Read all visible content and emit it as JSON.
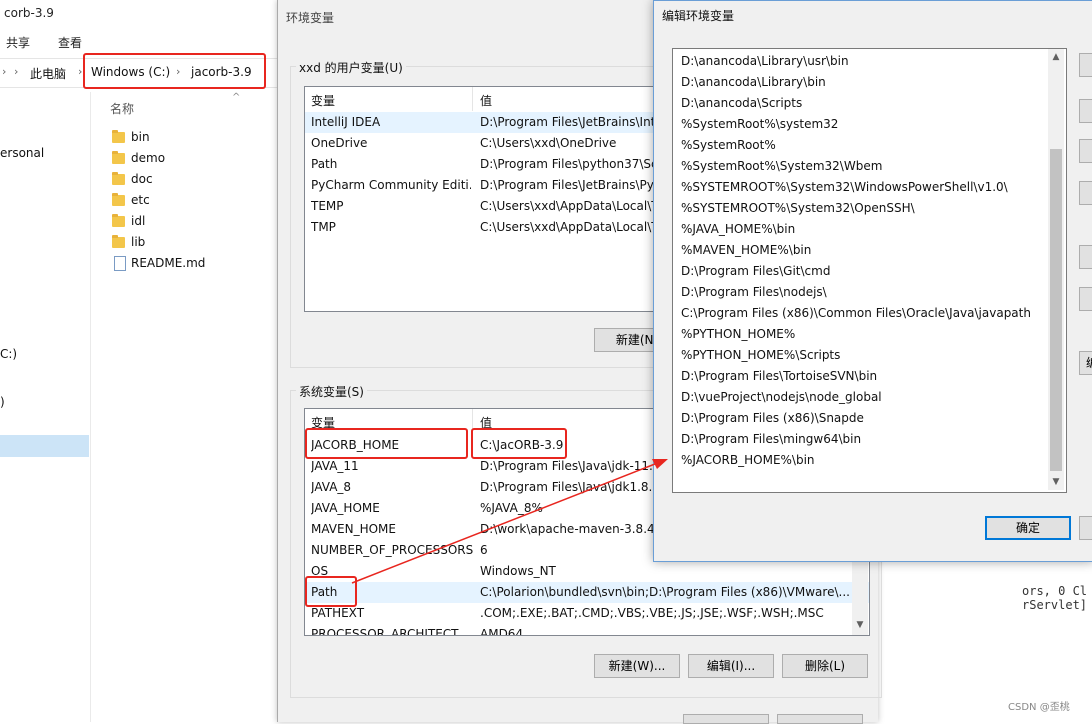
{
  "explorer": {
    "title": "corb-3.9",
    "ribbon_tabs": [
      "共享",
      "查看"
    ],
    "breadcrumbs": [
      "此电脑",
      "Windows (C:)",
      "jacorb-3.9"
    ],
    "nav_items": [
      "ersonal",
      "C:)",
      ")"
    ],
    "column_name": "名称",
    "files": [
      {
        "name": "bin",
        "type": "folder"
      },
      {
        "name": "demo",
        "type": "folder"
      },
      {
        "name": "doc",
        "type": "folder"
      },
      {
        "name": "etc",
        "type": "folder"
      },
      {
        "name": "idl",
        "type": "folder"
      },
      {
        "name": "lib",
        "type": "folder"
      },
      {
        "name": "README.md",
        "type": "file"
      }
    ]
  },
  "env_dialog": {
    "title": "环境变量",
    "user_group_label": "xxd 的用户变量(U)",
    "col_var": "变量",
    "col_val": "值",
    "user_vars": [
      {
        "name": "IntelliJ IDEA",
        "value": "D:\\Program Files\\JetBrains\\Inte"
      },
      {
        "name": "OneDrive",
        "value": "C:\\Users\\xxd\\OneDrive"
      },
      {
        "name": "Path",
        "value": "D:\\Program Files\\python37\\Scr"
      },
      {
        "name": "PyCharm Community Editi...",
        "value": "D:\\Program Files\\JetBrains\\PyC"
      },
      {
        "name": "TEMP",
        "value": "C:\\Users\\xxd\\AppData\\Local\\Te"
      },
      {
        "name": "TMP",
        "value": "C:\\Users\\xxd\\AppData\\Local\\Te"
      }
    ],
    "user_new_button": "新建(N)",
    "system_group_label": "系统变量(S)",
    "system_vars": [
      {
        "name": "JACORB_HOME",
        "value": "C:\\JacORB-3.9"
      },
      {
        "name": "JAVA_11",
        "value": "D:\\Program Files\\Java\\jdk-11.0"
      },
      {
        "name": "JAVA_8",
        "value": "D:\\Program Files\\Java\\jdk1.8.0"
      },
      {
        "name": "JAVA_HOME",
        "value": "%JAVA_8%"
      },
      {
        "name": "MAVEN_HOME",
        "value": "D:\\work\\apache-maven-3.8.4"
      },
      {
        "name": "NUMBER_OF_PROCESSORS",
        "value": "6"
      },
      {
        "name": "OS",
        "value": "Windows_NT"
      },
      {
        "name": "Path",
        "value": "C:\\Polarion\\bundled\\svn\\bin;D:\\Program Files (x86)\\VMware\\..."
      },
      {
        "name": "PATHEXT",
        "value": ".COM;.EXE;.BAT;.CMD;.VBS;.VBE;.JS;.JSE;.WSF;.WSH;.MSC"
      },
      {
        "name": "PROCESSOR_ARCHITECT...",
        "value": "AMD64"
      }
    ],
    "system_new_button": "新建(W)...",
    "system_edit_button": "编辑(I)...",
    "system_delete_button": "删除(L)"
  },
  "edit_dialog": {
    "title": "编辑环境变量",
    "paths": [
      "D:\\anancoda\\Library\\usr\\bin",
      "D:\\anancoda\\Library\\bin",
      "D:\\anancoda\\Scripts",
      "%SystemRoot%\\system32",
      "%SystemRoot%",
      "%SystemRoot%\\System32\\Wbem",
      "%SYSTEMROOT%\\System32\\WindowsPowerShell\\v1.0\\",
      "%SYSTEMROOT%\\System32\\OpenSSH\\",
      "%JAVA_HOME%\\bin",
      "%MAVEN_HOME%\\bin",
      "D:\\Program Files\\Git\\cmd",
      "D:\\Program Files\\nodejs\\",
      "C:\\Program Files (x86)\\Common Files\\Oracle\\Java\\javapath",
      "%PYTHON_HOME%",
      "%PYTHON_HOME%\\Scripts",
      "D:\\Program Files\\TortoiseSVN\\bin",
      "D:\\vueProject\\nodejs\\node_global",
      "D:\\Program Files (x86)\\Snapde",
      "D:\\Program Files\\mingw64\\bin",
      "%JACORB_HOME%\\bin"
    ],
    "side_button_partial": "编",
    "ok_button": "确定"
  },
  "background": {
    "console_lines": [
      "ors, 0 Cl",
      "rServlet]"
    ],
    "watermark": "CSDN @歪桃"
  },
  "colors": {
    "highlight_red": "#e8261f",
    "selection_blue": "#e5f3ff",
    "primary_border": "#0078d7"
  }
}
